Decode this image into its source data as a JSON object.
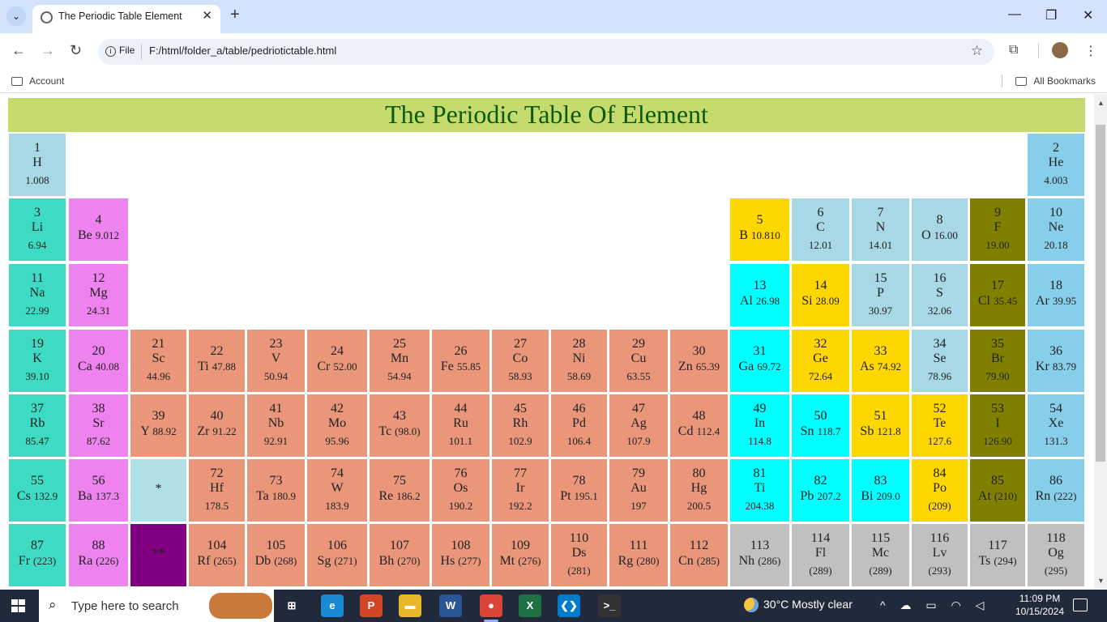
{
  "browser": {
    "tab_title": "The Periodic Table Element",
    "url_scheme": "File",
    "url": "F:/html/folder_a/table/pedriotictable.html",
    "bookmarks": {
      "left": "Account",
      "right": "All Bookmarks"
    }
  },
  "page": {
    "heading": "The Periodic Table Of Element",
    "colors": {
      "heading_bg": "#c6db6d",
      "heading_text": "#0a5a0a",
      "alkali": "#3ddbc4",
      "alkaline_earth": "#ee82ee",
      "transition": "#e9967a",
      "metal": "#00ffff",
      "metalloid": "#ffd700",
      "nonmetal": "#a8d8e6",
      "halogen": "#808000",
      "noble_gas": "#87ceeb",
      "lanthanide_marker": "#b0e0e6",
      "actinide_marker": "#800080",
      "unknown": "#c0c0c0"
    },
    "elements": [
      {
        "num": "1",
        "sym": "H",
        "mass": "1.008",
        "color": "#a8d8e6",
        "style": "stack"
      },
      {
        "num": "2",
        "sym": "He",
        "mass": "4.003",
        "color": "#87ceeb",
        "style": "stack"
      },
      {
        "num": "3",
        "sym": "Li",
        "mass": "6.94",
        "color": "#3ddbc4",
        "style": "stack"
      },
      {
        "num": "4",
        "sym": "Be",
        "mass": "9.012",
        "color": "#ee82ee",
        "style": "inline"
      },
      {
        "num": "5",
        "sym": "B",
        "mass": "10.810",
        "color": "#ffd700",
        "style": "inline"
      },
      {
        "num": "6",
        "sym": "C",
        "mass": "12.01",
        "color": "#a8d8e6",
        "style": "stack"
      },
      {
        "num": "7",
        "sym": "N",
        "mass": "14.01",
        "color": "#a8d8e6",
        "style": "stack"
      },
      {
        "num": "8",
        "sym": "O",
        "mass": "16.00",
        "color": "#a8d8e6",
        "style": "inline"
      },
      {
        "num": "9",
        "sym": "F",
        "mass": "19.00",
        "color": "#808000",
        "style": "stack"
      },
      {
        "num": "10",
        "sym": "Ne",
        "mass": "20.18",
        "color": "#87ceeb",
        "style": "stack"
      },
      {
        "num": "11",
        "sym": "Na",
        "mass": "22.99",
        "color": "#3ddbc4",
        "style": "stack"
      },
      {
        "num": "12",
        "sym": "Mg",
        "mass": "24.31",
        "color": "#ee82ee",
        "style": "stack"
      },
      {
        "num": "13",
        "sym": "Al",
        "mass": "26.98",
        "color": "#00ffff",
        "style": "inline"
      },
      {
        "num": "14",
        "sym": "Si",
        "mass": "28.09",
        "color": "#ffd700",
        "style": "inline"
      },
      {
        "num": "15",
        "sym": "P",
        "mass": "30.97",
        "color": "#a8d8e6",
        "style": "stack"
      },
      {
        "num": "16",
        "sym": "S",
        "mass": "32.06",
        "color": "#a8d8e6",
        "style": "stack"
      },
      {
        "num": "17",
        "sym": "Cl",
        "mass": "35.45",
        "color": "#808000",
        "style": "inline"
      },
      {
        "num": "18",
        "sym": "Ar",
        "mass": "39.95",
        "color": "#87ceeb",
        "style": "inline"
      },
      {
        "num": "19",
        "sym": "K",
        "mass": "39.10",
        "color": "#3ddbc4",
        "style": "stack"
      },
      {
        "num": "20",
        "sym": "Ca",
        "mass": "40.08",
        "color": "#ee82ee",
        "style": "inline"
      },
      {
        "num": "21",
        "sym": "Sc",
        "mass": "44.96",
        "color": "#e9967a",
        "style": "stack"
      },
      {
        "num": "22",
        "sym": "Ti",
        "mass": "47.88",
        "color": "#e9967a",
        "style": "inline"
      },
      {
        "num": "23",
        "sym": "V",
        "mass": "50.94",
        "color": "#e9967a",
        "style": "stack"
      },
      {
        "num": "24",
        "sym": "Cr",
        "mass": "52.00",
        "color": "#e9967a",
        "style": "inline"
      },
      {
        "num": "25",
        "sym": "Mn",
        "mass": "54.94",
        "color": "#e9967a",
        "style": "stack"
      },
      {
        "num": "26",
        "sym": "Fe",
        "mass": "55.85",
        "color": "#e9967a",
        "style": "inline"
      },
      {
        "num": "27",
        "sym": "Co",
        "mass": "58.93",
        "color": "#e9967a",
        "style": "stack"
      },
      {
        "num": "28",
        "sym": "Ni",
        "mass": "58.69",
        "color": "#e9967a",
        "style": "stack"
      },
      {
        "num": "29",
        "sym": "Cu",
        "mass": "63.55",
        "color": "#e9967a",
        "style": "stack"
      },
      {
        "num": "30",
        "sym": "Zn",
        "mass": "65.39",
        "color": "#e9967a",
        "style": "inline"
      },
      {
        "num": "31",
        "sym": "Ga",
        "mass": "69.72",
        "color": "#00ffff",
        "style": "inline"
      },
      {
        "num": "32",
        "sym": "Ge",
        "mass": "72.64",
        "color": "#ffd700",
        "style": "stack"
      },
      {
        "num": "33",
        "sym": "As",
        "mass": "74.92",
        "color": "#ffd700",
        "style": "inline"
      },
      {
        "num": "34",
        "sym": "Se",
        "mass": "78.96",
        "color": "#a8d8e6",
        "style": "stack"
      },
      {
        "num": "35",
        "sym": "Br",
        "mass": "79.90",
        "color": "#808000",
        "style": "stack"
      },
      {
        "num": "36",
        "sym": "Kr",
        "mass": "83.79",
        "color": "#87ceeb",
        "style": "inline"
      },
      {
        "num": "37",
        "sym": "Rb",
        "mass": "85.47",
        "color": "#3ddbc4",
        "style": "stack"
      },
      {
        "num": "38",
        "sym": "Sr",
        "mass": "87.62",
        "color": "#ee82ee",
        "style": "stack"
      },
      {
        "num": "39",
        "sym": "Y",
        "mass": "88.92",
        "color": "#e9967a",
        "style": "inline"
      },
      {
        "num": "40",
        "sym": "Zr",
        "mass": "91.22",
        "color": "#e9967a",
        "style": "inline"
      },
      {
        "num": "41",
        "sym": "Nb",
        "mass": "92.91",
        "color": "#e9967a",
        "style": "stack"
      },
      {
        "num": "42",
        "sym": "Mo",
        "mass": "95.96",
        "color": "#e9967a",
        "style": "stack"
      },
      {
        "num": "43",
        "sym": "Tc",
        "mass": "(98.0)",
        "color": "#e9967a",
        "style": "inline"
      },
      {
        "num": "44",
        "sym": "Ru",
        "mass": "101.1",
        "color": "#e9967a",
        "style": "stack"
      },
      {
        "num": "45",
        "sym": "Rh",
        "mass": "102.9",
        "color": "#e9967a",
        "style": "stack"
      },
      {
        "num": "46",
        "sym": "Pd",
        "mass": "106.4",
        "color": "#e9967a",
        "style": "stack"
      },
      {
        "num": "47",
        "sym": "Ag",
        "mass": "107.9",
        "color": "#e9967a",
        "style": "stack"
      },
      {
        "num": "48",
        "sym": "Cd",
        "mass": "112.4",
        "color": "#e9967a",
        "style": "inline"
      },
      {
        "num": "49",
        "sym": "In",
        "mass": "114.8",
        "color": "#00ffff",
        "style": "stack"
      },
      {
        "num": "50",
        "sym": "Sn",
        "mass": "118.7",
        "color": "#00ffff",
        "style": "inline"
      },
      {
        "num": "51",
        "sym": "Sb",
        "mass": "121.8",
        "color": "#ffd700",
        "style": "inline"
      },
      {
        "num": "52",
        "sym": "Te",
        "mass": "127.6",
        "color": "#ffd700",
        "style": "stack"
      },
      {
        "num": "53",
        "sym": "I",
        "mass": "126.90",
        "color": "#808000",
        "style": "stack"
      },
      {
        "num": "54",
        "sym": "Xe",
        "mass": "131.3",
        "color": "#87ceeb",
        "style": "stack"
      },
      {
        "num": "55",
        "sym": "Cs",
        "mass": "132.9",
        "color": "#3ddbc4",
        "style": "inline"
      },
      {
        "num": "56",
        "sym": "Ba",
        "mass": "137.3",
        "color": "#ee82ee",
        "style": "inline"
      },
      {
        "num": "",
        "sym": "*",
        "mass": "",
        "color": "#b0e0e6",
        "style": "center"
      },
      {
        "num": "72",
        "sym": "Hf",
        "mass": "178.5",
        "color": "#e9967a",
        "style": "stack"
      },
      {
        "num": "73",
        "sym": "Ta",
        "mass": "180.9",
        "color": "#e9967a",
        "style": "inline"
      },
      {
        "num": "74",
        "sym": "W",
        "mass": "183.9",
        "color": "#e9967a",
        "style": "stack"
      },
      {
        "num": "75",
        "sym": "Re",
        "mass": "186.2",
        "color": "#e9967a",
        "style": "inline"
      },
      {
        "num": "76",
        "sym": "Os",
        "mass": "190.2",
        "color": "#e9967a",
        "style": "stack"
      },
      {
        "num": "77",
        "sym": "Ir",
        "mass": "192.2",
        "color": "#e9967a",
        "style": "stack"
      },
      {
        "num": "78",
        "sym": "Pt",
        "mass": "195.1",
        "color": "#e9967a",
        "style": "inline"
      },
      {
        "num": "79",
        "sym": "Au",
        "mass": "197",
        "color": "#e9967a",
        "style": "stack"
      },
      {
        "num": "80",
        "sym": "Hg",
        "mass": "200.5",
        "color": "#e9967a",
        "style": "stack"
      },
      {
        "num": "81",
        "sym": "Ti",
        "mass": "204.38",
        "color": "#00ffff",
        "style": "stack"
      },
      {
        "num": "82",
        "sym": "Pb",
        "mass": "207.2",
        "color": "#00ffff",
        "style": "inline"
      },
      {
        "num": "83",
        "sym": "Bi",
        "mass": "209.0",
        "color": "#00ffff",
        "style": "inline"
      },
      {
        "num": "84",
        "sym": "Po",
        "mass": "(209)",
        "color": "#ffd700",
        "style": "stack"
      },
      {
        "num": "85",
        "sym": "At",
        "mass": "(210)",
        "color": "#808000",
        "style": "inline"
      },
      {
        "num": "86",
        "sym": "Rn",
        "mass": "(222)",
        "color": "#87ceeb",
        "style": "inline"
      },
      {
        "num": "87",
        "sym": "Fr",
        "mass": "(223)",
        "color": "#3ddbc4",
        "style": "inline"
      },
      {
        "num": "88",
        "sym": "Ra",
        "mass": "(226)",
        "color": "#ee82ee",
        "style": "inline"
      },
      {
        "num": "",
        "sym": "**",
        "mass": "",
        "color": "#800080",
        "style": "center"
      },
      {
        "num": "104",
        "sym": "Rf",
        "mass": "(265)",
        "color": "#e9967a",
        "style": "inline"
      },
      {
        "num": "105",
        "sym": "Db",
        "mass": "(268)",
        "color": "#e9967a",
        "style": "inline"
      },
      {
        "num": "106",
        "sym": "Sg",
        "mass": "(271)",
        "color": "#e9967a",
        "style": "inline"
      },
      {
        "num": "107",
        "sym": "Bh",
        "mass": "(270)",
        "color": "#e9967a",
        "style": "inline"
      },
      {
        "num": "108",
        "sym": "Hs",
        "mass": "(277)",
        "color": "#e9967a",
        "style": "inline"
      },
      {
        "num": "109",
        "sym": "Mt",
        "mass": "(276)",
        "color": "#e9967a",
        "style": "inline"
      },
      {
        "num": "110",
        "sym": "Ds",
        "mass": "(281)",
        "color": "#e9967a",
        "style": "stack"
      },
      {
        "num": "111",
        "sym": "Rg",
        "mass": "(280)",
        "color": "#e9967a",
        "style": "inline"
      },
      {
        "num": "112",
        "sym": "Cn",
        "mass": "(285)",
        "color": "#e9967a",
        "style": "inline"
      },
      {
        "num": "113",
        "sym": "Nh",
        "mass": "(286)",
        "color": "#c0c0c0",
        "style": "inline"
      },
      {
        "num": "114",
        "sym": "Fl",
        "mass": "(289)",
        "color": "#c0c0c0",
        "style": "stack"
      },
      {
        "num": "115",
        "sym": "Mc",
        "mass": "(289)",
        "color": "#c0c0c0",
        "style": "stack"
      },
      {
        "num": "116",
        "sym": "Lv",
        "mass": "(293)",
        "color": "#c0c0c0",
        "style": "stack"
      },
      {
        "num": "117",
        "sym": "Ts",
        "mass": "(294)",
        "color": "#c0c0c0",
        "style": "inline"
      },
      {
        "num": "118",
        "sym": "Og",
        "mass": "(295)",
        "color": "#c0c0c0",
        "style": "stack"
      }
    ]
  },
  "taskbar": {
    "search_placeholder": "Type here to search",
    "weather": "30°C  Mostly clear",
    "time": "11:09 PM",
    "date": "10/15/2024",
    "apps": [
      {
        "name": "task-view-icon",
        "label": "⊞",
        "color": "#202a3a"
      },
      {
        "name": "edge-icon",
        "label": "e",
        "color": "#1a8ad4"
      },
      {
        "name": "powerpoint-icon",
        "label": "P",
        "color": "#d24726"
      },
      {
        "name": "file-explorer-icon",
        "label": "▬",
        "color": "#e8b72a"
      },
      {
        "name": "word-icon",
        "label": "W",
        "color": "#2b5797"
      },
      {
        "name": "chrome-icon",
        "label": "●",
        "color": "#db4437"
      },
      {
        "name": "excel-icon",
        "label": "X",
        "color": "#1e7145"
      },
      {
        "name": "vscode-icon",
        "label": "❮❯",
        "color": "#007acc"
      },
      {
        "name": "terminal-icon",
        "label": ">_",
        "color": "#333"
      }
    ]
  }
}
